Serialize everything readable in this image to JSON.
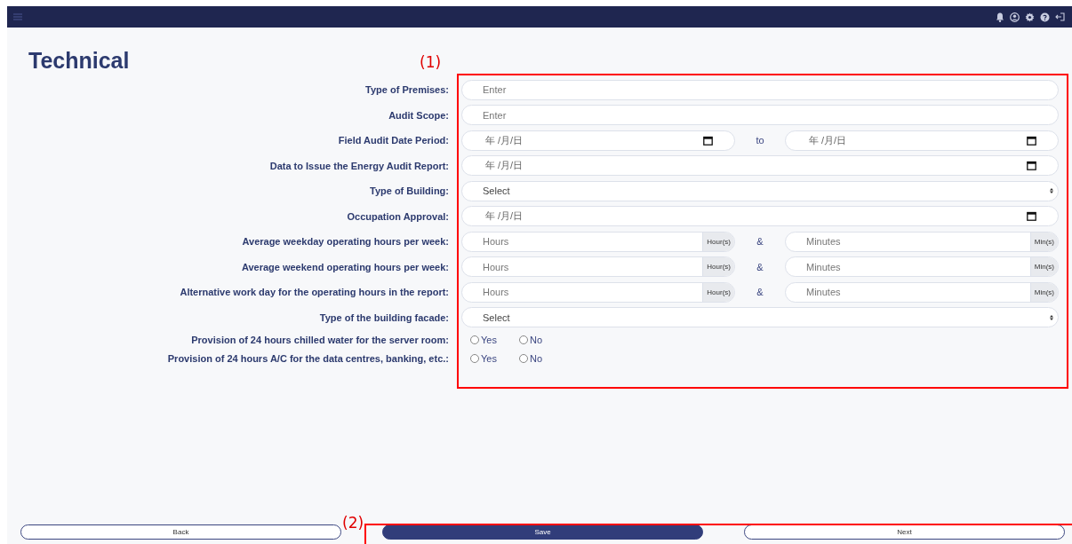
{
  "title": "Technical",
  "annotations": [
    "(1)",
    "(2)"
  ],
  "fields": [
    {
      "label": "Type of Premises:",
      "kind": "text",
      "placeholder": "Enter"
    },
    {
      "label": "Audit Scope:",
      "kind": "text",
      "placeholder": "Enter"
    },
    {
      "label": "Field Audit Date Period:",
      "kind": "daterange",
      "placeholder": "年 /月/日",
      "separator": "to",
      "placeholder_2": "年 /月/日"
    },
    {
      "label": "Data to Issue the Energy Audit Report:",
      "kind": "date",
      "placeholder": "年 /月/日"
    },
    {
      "label": "Type of Building:",
      "kind": "select",
      "placeholder": "Select"
    },
    {
      "label": "Occupation Approval:",
      "kind": "date",
      "placeholder": "年 /月/日"
    },
    {
      "label": "Average weekday operating hours per week:",
      "kind": "duration",
      "placeholder": "Hours",
      "unit": "Hour(s)",
      "separator": "&",
      "placeholder_2": "Minutes",
      "unit_2": "Min(s)"
    },
    {
      "label": "Average weekend operating hours per week:",
      "kind": "duration",
      "placeholder": "Hours",
      "unit": "Hour(s)",
      "separator": "&",
      "placeholder_2": "Minutes",
      "unit_2": "Min(s)"
    },
    {
      "label": "Alternative work day for the operating hours in the report:",
      "kind": "duration",
      "placeholder": "Hours",
      "unit": "Hour(s)",
      "separator": "&",
      "placeholder_2": "Minutes",
      "unit_2": "Min(s)"
    },
    {
      "label": "Type of the building facade:",
      "kind": "select",
      "placeholder": "Select"
    },
    {
      "label": "Provision of 24 hours chilled water for the server room:",
      "kind": "radio",
      "options": [
        {
          "label": "Yes",
          "selected": false
        },
        {
          "label": "No",
          "selected": false
        }
      ]
    },
    {
      "label": "Provision of 24 hours A/C for the data centres, banking, etc.:",
      "kind": "radio",
      "options": [
        {
          "label": "Yes",
          "selected": false
        },
        {
          "label": "No",
          "selected": false
        }
      ]
    }
  ],
  "buttons": [
    {
      "label": "Back",
      "primary": false
    },
    {
      "label": "Save",
      "primary": true
    },
    {
      "label": "Next",
      "primary": false
    }
  ]
}
